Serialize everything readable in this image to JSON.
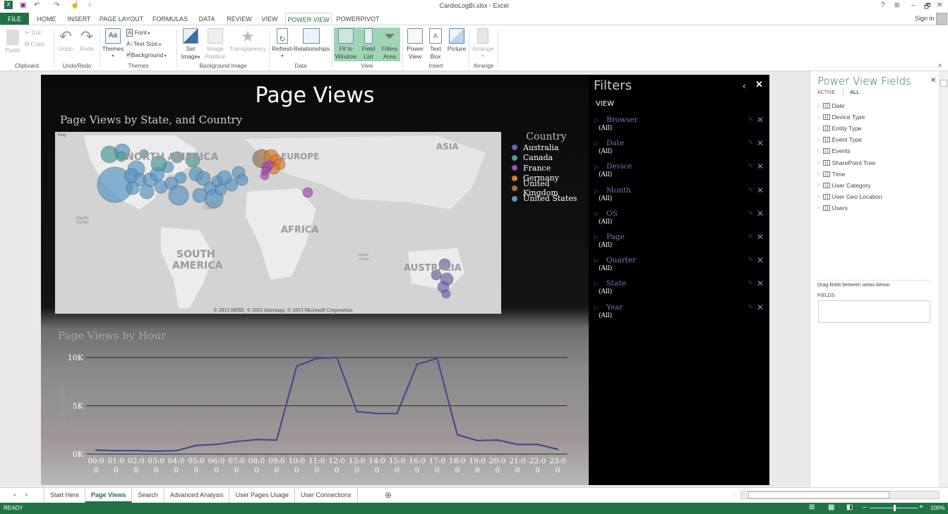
{
  "window": {
    "title": "CardioLogBI.xlsx - Excel",
    "sign_in": "Sign in",
    "help": "?",
    "minimize": "–",
    "restore": "🗗",
    "close": "✕"
  },
  "ribbon_tabs": [
    "FILE",
    "HOME",
    "INSERT",
    "PAGE LAYOUT",
    "FORMULAS",
    "DATA",
    "REVIEW",
    "VIEW",
    "POWER VIEW",
    "POWERPIVOT"
  ],
  "active_ribbon_tab": "POWER VIEW",
  "ribbon": {
    "clipboard": {
      "label": "Clipboard",
      "paste": "Paste",
      "cut": "Cut",
      "copy": "Copy"
    },
    "undo_redo": {
      "label": "Undo/Redo",
      "undo": "Undo",
      "redo": "Redo"
    },
    "themes": {
      "label": "Themes",
      "themes": "Themes",
      "font": "Font",
      "text_size": "Text Size",
      "background": "Background"
    },
    "background_image": {
      "label": "Background Image",
      "set_image_1": "Set",
      "set_image_2": "Image",
      "image_position_1": "Image",
      "image_position_2": "Position",
      "transparency": "Transparency"
    },
    "data": {
      "label": "Data",
      "refresh": "Refresh",
      "relationships": "Relationships"
    },
    "view": {
      "label": "View",
      "fit_1": "Fit to",
      "fit_2": "Window",
      "field_1": "Field",
      "field_2": "List",
      "filters_1": "Filters",
      "filters_2": "Area"
    },
    "insert": {
      "label": "Insert",
      "power_1": "Power",
      "power_2": "View",
      "text_1": "Text",
      "text_2": "Box",
      "picture": "Picture"
    },
    "arrange": {
      "label": "Arrange",
      "arrange": "Arrange"
    }
  },
  "report": {
    "title": "Page Views",
    "map": {
      "title": "Page Views by State, and Country",
      "bing": "bing",
      "copyright": "© 2015 HERE, © 2015 Intermap, © 2015 Microsoft Corporation",
      "labels": {
        "north_america": "NORTH AMERICA",
        "south_america_1": "SOUTH",
        "south_america_2": "AMERICA",
        "europe": "EUROPE",
        "asia": "ASIA",
        "africa": "AFRICA",
        "australia": "AUSTRALIA",
        "pacific": "Pacific Ocean",
        "atlantic": "Atlantic Ocean",
        "indian": "Indian Ocean"
      },
      "legend_title": "Country",
      "legend": [
        {
          "name": "Australia",
          "color": "#6b67a8"
        },
        {
          "name": "Canada",
          "color": "#4e9a9a"
        },
        {
          "name": "France",
          "color": "#a94ab5"
        },
        {
          "name": "Germany",
          "color": "#d77a2a"
        },
        {
          "name": "United Kingdom",
          "color": "#9a7152"
        },
        {
          "name": "United States",
          "color": "#5a95c2"
        }
      ]
    }
  },
  "chart_data": {
    "type": "line",
    "title": "Page Views by Hour",
    "xlabel": "",
    "ylabel": "(thousands)",
    "categories": [
      "00:00",
      "01:00",
      "02:00",
      "03:00",
      "04:00",
      "05:00",
      "06:00",
      "07:00",
      "08:00",
      "09:00",
      "10:00",
      "11:00",
      "12:00",
      "13:00",
      "14:00",
      "15:00",
      "16:00",
      "17:00",
      "18:00",
      "19:00",
      "20:00",
      "21:00",
      "22:00",
      "23:00"
    ],
    "tick_labels_wrapped": [
      [
        "00:0",
        "0"
      ],
      [
        "01:0",
        "0"
      ],
      [
        "02:0",
        "0"
      ],
      [
        "03:0",
        "0"
      ],
      [
        "04:0",
        "0"
      ],
      [
        "05:0",
        "0"
      ],
      [
        "06:0",
        "0"
      ],
      [
        "07:0",
        "0"
      ],
      [
        "08:0",
        "0"
      ],
      [
        "09:0",
        "0"
      ],
      [
        "10:0",
        "0"
      ],
      [
        "11:0",
        "0"
      ],
      [
        "12:0",
        "0"
      ],
      [
        "13:0",
        "0"
      ],
      [
        "14:0",
        "0"
      ],
      [
        "15:0",
        "0"
      ],
      [
        "16:0",
        "0"
      ],
      [
        "17:0",
        "0"
      ],
      [
        "18:0",
        "0"
      ],
      [
        "19:0",
        "0"
      ],
      [
        "20:0",
        "0"
      ],
      [
        "21:0",
        "0"
      ],
      [
        "22:0",
        "0"
      ],
      [
        "23:0",
        "0"
      ]
    ],
    "series": [
      {
        "name": "Page Views",
        "color": "#4a478f",
        "values": [
          400,
          350,
          350,
          300,
          350,
          900,
          1000,
          1300,
          1500,
          1450,
          9100,
          9900,
          10000,
          4400,
          4200,
          4200,
          9300,
          9900,
          2000,
          1400,
          1450,
          1000,
          1000,
          500
        ]
      }
    ],
    "ylim": [
      0,
      10000
    ],
    "yticks": [
      {
        "value": 0,
        "label": "0K"
      },
      {
        "value": 5000,
        "label": "5K"
      },
      {
        "value": 10000,
        "label": "10K"
      }
    ],
    "grid": true
  },
  "filters": {
    "title": "Filters",
    "section": "VIEW",
    "items": [
      {
        "name": "Browser",
        "value": "(All)"
      },
      {
        "name": "Date",
        "value": "(All)"
      },
      {
        "name": "Device",
        "value": "(All)"
      },
      {
        "name": "Month",
        "value": "(All)"
      },
      {
        "name": "OS",
        "value": "(All)"
      },
      {
        "name": "Page",
        "value": "(All)"
      },
      {
        "name": "Quarter",
        "value": "(All)"
      },
      {
        "name": "State",
        "value": "(All)"
      },
      {
        "name": "Year",
        "value": "(All)"
      }
    ]
  },
  "fields_pane": {
    "title": "Power View Fields",
    "tab_active": "ACTIVE",
    "tab_all": "ALL",
    "tables": [
      "Date",
      "Device Type",
      "Entity Type",
      "Event Type",
      "Events",
      "SharePoint Tree",
      "Time",
      "User Category",
      "User Geo Location",
      "Users"
    ],
    "drag_hint": "Drag fields between areas below:",
    "fields_label": "FIELDS"
  },
  "sheet_tabs": [
    "Start Here",
    "Page Views",
    "Search",
    "Advanced Analysis",
    "User Pages Usage",
    "User Connections"
  ],
  "active_sheet": "Page Views",
  "status": {
    "ready": "READY",
    "zoom": "100%",
    "zoom_value_percent": 100
  }
}
